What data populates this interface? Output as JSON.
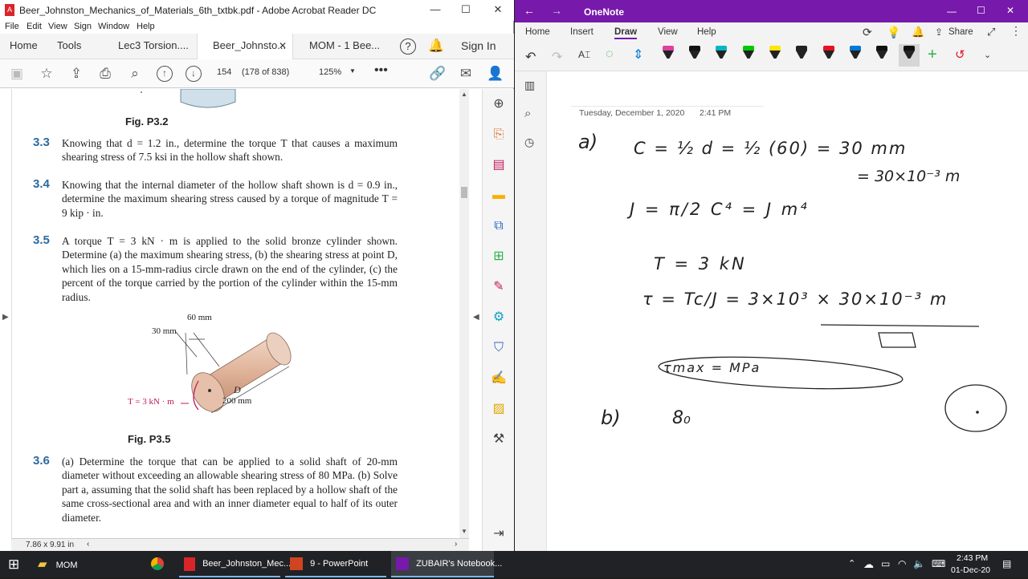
{
  "acrobat": {
    "title": "Beer_Johnston_Mechanics_of_Materials_6th_txtbk.pdf - Adobe Acrobat Reader DC",
    "menu": [
      "File",
      "Edit",
      "View",
      "Sign",
      "Window",
      "Help"
    ],
    "tabs": {
      "home": "Home",
      "tools": "Tools",
      "doc1": "Lec3 Torsion....",
      "doc2": "Beer_Johnsto...",
      "doc3": "MOM - 1 Bee...",
      "signin": "Sign In"
    },
    "toolbar": {
      "page_input": "154",
      "page_count": "(178 of 838)",
      "zoom": "125%"
    },
    "status_size": "7.86 x 9.91 in",
    "document": {
      "fig32_caption": "Fig. P3.2",
      "p33_num": "3.3",
      "p33_text": "Knowing that d = 1.2 in., determine the torque T that causes a maximum shearing stress of 7.5 ksi in the hollow shaft shown.",
      "p34_num": "3.4",
      "p34_text": "Knowing that the internal diameter of the hollow shaft shown is d = 0.9 in., determine the maximum shearing stress caused by a torque of magnitude T = 9 kip · in.",
      "p35_num": "3.5",
      "p35_text": "A torque T = 3 kN · m is applied to the solid bronze cylinder shown. Determine (a) the maximum shearing stress, (b) the shearing stress at point D, which lies on a 15-mm-radius circle drawn on the end of the cylinder, (c) the percent of the torque carried by the portion of the cylinder within the 15-mm radius.",
      "fig35": {
        "dim60": "60 mm",
        "dim30": "30 mm",
        "pointD": "D",
        "dim200": "200 mm",
        "torque": "T = 3 kN · m"
      },
      "fig35_caption": "Fig. P3.5",
      "p36_num": "3.6",
      "p36_text": "(a) Determine the torque that can be applied to a solid shaft of 20-mm diameter without exceeding an allowable shearing stress of 80 MPa. (b) Solve part a, assuming that the solid shaft has been replaced by a hollow shaft of the same cross-sectional area and with an inner diameter equal to half of its outer diameter."
    }
  },
  "onenote": {
    "title": "OneNote",
    "ribbon_tabs": [
      "Home",
      "Insert",
      "Draw",
      "View",
      "Help"
    ],
    "share": "Share",
    "date": "Tuesday, December 1, 2020",
    "time": "2:41 PM",
    "pen_colors": [
      "#e040a0",
      "#111111",
      "#00b7c3",
      "#00c800",
      "#ffe600",
      "#222222",
      "#e81123",
      "#0078d7",
      "#111111",
      "#111111"
    ],
    "ink": {
      "a_label": "a)",
      "line1": "C = ½ d = ½ (60) = 30 mm",
      "line1b": "= 30×10⁻³ m",
      "line2": "J = π/2 C⁴ = J m⁴",
      "line3": "T = 3 kN",
      "line4": "τ = Tc/J = 3×10³ × 30×10⁻³ m",
      "line5": "τmax = MPa",
      "b_label": "b)",
      "b_text": "8₀"
    }
  },
  "taskbar": {
    "items": [
      "MOM",
      "Beer_Johnston_Mec...",
      "9 - PowerPoint",
      "ZUBAIR's Notebook..."
    ],
    "time": "2:43 PM",
    "date": "01-Dec-20"
  }
}
